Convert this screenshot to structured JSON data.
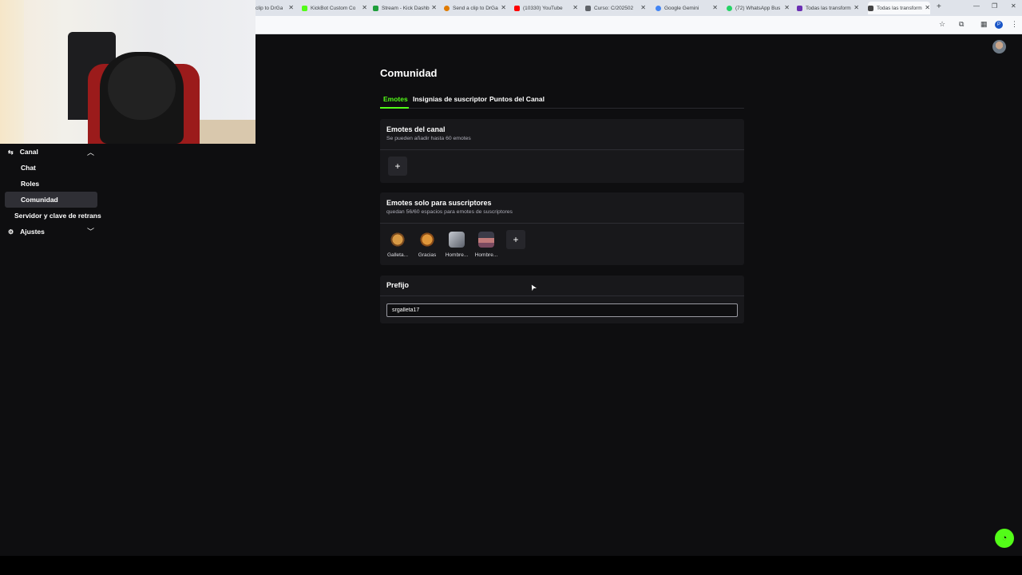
{
  "browser": {
    "tabs": [
      {
        "label": "clip to DrGa",
        "color": "#7a7a7a"
      },
      {
        "label": "KickBot Custom Co",
        "color": "#53fc18"
      },
      {
        "label": "Stream - Kick Dashb",
        "color": "#1e9e3a"
      },
      {
        "label": "Send a clip to DrGa",
        "color": "#e07b00"
      },
      {
        "label": "(10330) YouTube",
        "color": "#ff0000"
      },
      {
        "label": "Curso: C/202502",
        "color": "#5f6368"
      },
      {
        "label": "Google Gemini",
        "color": "#4285f4"
      },
      {
        "label": "(72) WhatsApp Bus",
        "color": "#25d366"
      },
      {
        "label": "Todas las transform",
        "color": "#6b2fb3"
      },
      {
        "label": "Todas las transform",
        "color": "#444444"
      }
    ],
    "new_tab": "+",
    "profile_letter": "P"
  },
  "sidebar": {
    "canal": "Canal",
    "items": [
      "Chat",
      "Roles",
      "Comunidad"
    ],
    "servidor": "Servidor y clave de retrans",
    "ajustes": "Ajustes"
  },
  "main": {
    "title": "Comunidad",
    "tabs": [
      "Emotes",
      "Insignias de suscriptor",
      "Puntos del Canal"
    ],
    "channel_emotes": {
      "title": "Emotes del canal",
      "subtitle": "Se pueden añadir hasta 60 emotes",
      "add": "+"
    },
    "sub_emotes": {
      "title": "Emotes solo para suscriptores",
      "subtitle": "quedan 56/60 espacios para emotes de suscriptores",
      "emotes": [
        {
          "name": "Galleta...",
          "color": "#c98a3a"
        },
        {
          "name": "Gracias",
          "color": "#d2882f"
        },
        {
          "name": "Hombre...",
          "color": "#8a8f99"
        },
        {
          "name": "Hombre...",
          "color": "#7a4a60"
        }
      ],
      "add": "+"
    },
    "prefix": {
      "title": "Prefijo",
      "value": "srgalleta17"
    }
  },
  "colors": {
    "accent": "#53fc18",
    "background": "#0e0e10",
    "card": "#18181b"
  }
}
